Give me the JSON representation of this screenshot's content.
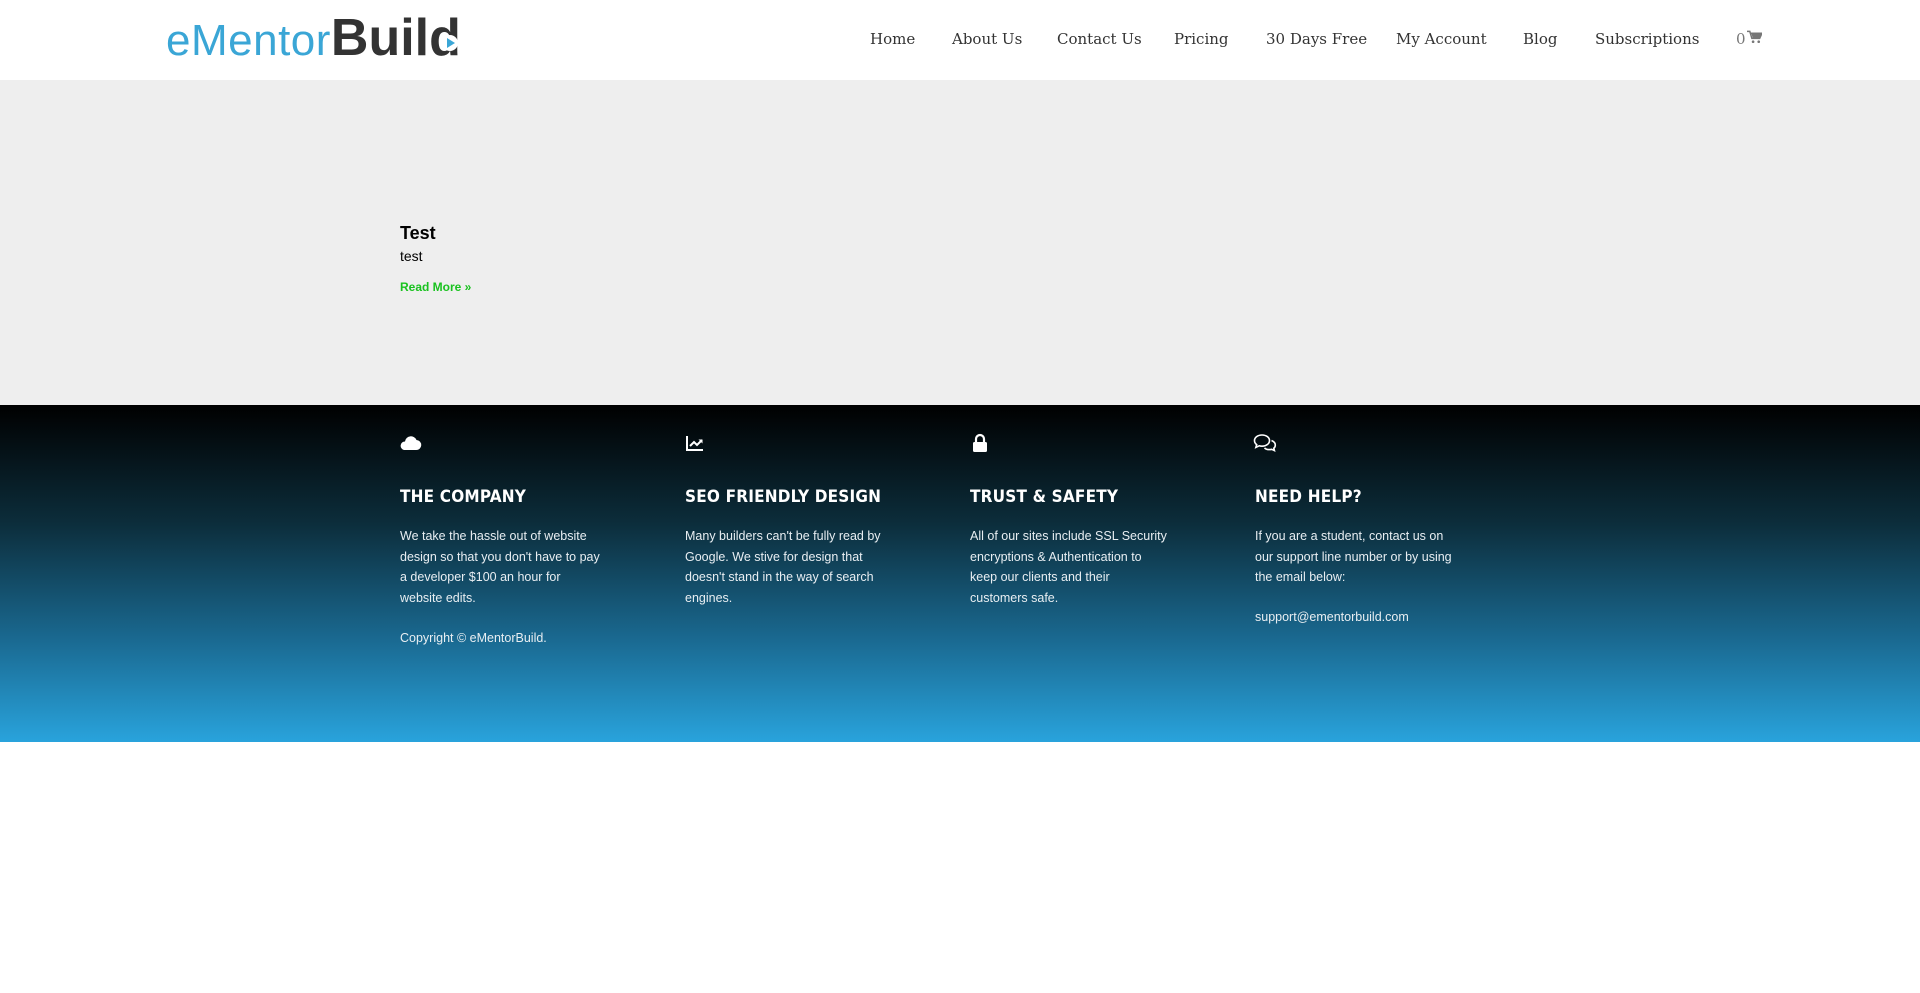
{
  "logo": {
    "light": "eMentor",
    "bold": "Build"
  },
  "nav": [
    {
      "label": "Home"
    },
    {
      "label": "About Us"
    },
    {
      "label": "Contact Us"
    },
    {
      "label": "Pricing"
    },
    {
      "label": "30 Days Free"
    },
    {
      "label": "My Account"
    },
    {
      "label": "Blog"
    },
    {
      "label": "Subscriptions"
    }
  ],
  "cart": {
    "count": "0",
    "icon": "cart-icon"
  },
  "post": {
    "title": "Test",
    "excerpt": "test",
    "read_more": "Read More »",
    "read_more_color": "#19c21f"
  },
  "footer": {
    "columns": [
      {
        "icon": "cloud-icon",
        "title": "THE COMPANY",
        "text": "We take the hassle out of website design so that you don't have to pay a developer $100 an hour for website edits.",
        "extra": "Copyright © eMentorBuild."
      },
      {
        "icon": "chart-line-icon",
        "title": "SEO FRIENDLY DESIGN",
        "text": "Many builders can't be fully read by Google. We stive for design that doesn't stand in the way of search engines.",
        "extra": ""
      },
      {
        "icon": "lock-icon",
        "title": "TRUST & SAFETY",
        "text": "All of our sites include SSL Security encryptions & Authentication to keep our clients and their customers safe.",
        "extra": ""
      },
      {
        "icon": "chat-icon",
        "title": "NEED HELP?",
        "text": "If you are a student, contact us on our support line number or by using the email below:",
        "extra": "support@ementorbuild.com"
      }
    ]
  },
  "colors": {
    "brand_blue": "#3aa6d6",
    "footer_top": "#000000",
    "footer_bottom": "#29a3dc",
    "main_bg": "#eeeeee"
  }
}
